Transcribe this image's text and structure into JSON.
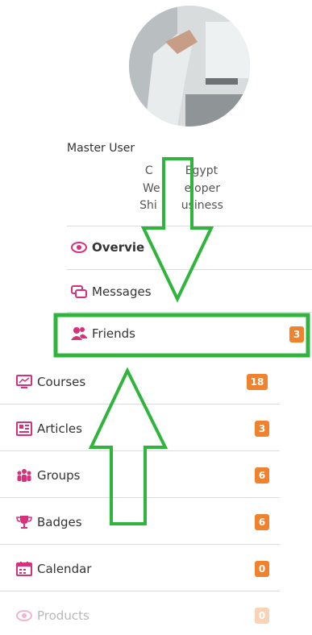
{
  "profile": {
    "name": "Master User",
    "line1_left": "C",
    "line1_right": "Egypt",
    "line2_left": "We",
    "line2_right": "eloper",
    "line3_left": "Shi",
    "line3_right": "usiness"
  },
  "menu": [
    {
      "label": "Overvie",
      "icon": "eye-icon",
      "count": ""
    },
    {
      "label": "Messages",
      "icon": "chat-bubbles-icon",
      "count": ""
    },
    {
      "label": "Friends",
      "icon": "users-icon",
      "count": "3"
    },
    {
      "label": "Courses",
      "icon": "monitor-icon",
      "count": "18"
    },
    {
      "label": "Articles",
      "icon": "newspaper-icon",
      "count": "3"
    },
    {
      "label": "Groups",
      "icon": "group-icon",
      "count": "6"
    },
    {
      "label": "Badges",
      "icon": "trophy-icon",
      "count": "6"
    },
    {
      "label": "Calendar",
      "icon": "calendar-icon",
      "count": "0"
    },
    {
      "label": "Products",
      "icon": "eye-icon",
      "count": "0"
    }
  ],
  "colors": {
    "icon_magenta": "#d6317a",
    "badge_orange": "#f0822e",
    "annotation_green": "#2fb53b"
  }
}
